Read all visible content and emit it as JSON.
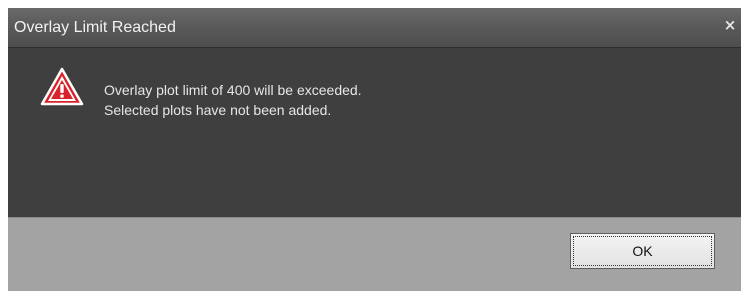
{
  "dialog": {
    "title": "Overlay Limit Reached",
    "close_symbol": "×",
    "icon": "warning-triangle-icon",
    "message_lines": [
      "Overlay plot limit of 400 will be exceeded.",
      "Selected plots have not been added."
    ],
    "ok_label": "OK"
  },
  "colors": {
    "warning_red": "#d8232a",
    "body_bg": "#3f3f3f",
    "footer_bg": "#a3a3a3"
  }
}
